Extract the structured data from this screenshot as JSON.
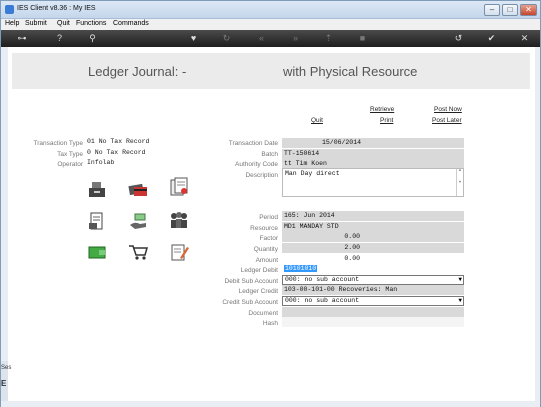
{
  "window": {
    "title": "IES Client v8.36 : My IES"
  },
  "menu": [
    "Help",
    "Submit",
    "Quit",
    "Functions",
    "Commands"
  ],
  "banner": {
    "left": "Ledger Journal: -",
    "right": "with Physical Resource"
  },
  "links": {
    "retrieve": "Retrieve",
    "post_now": "Post Now",
    "quit": "Quit",
    "print": "Print",
    "post_later": "Post Later"
  },
  "left_info": {
    "transaction_type_label": "Transaction Type",
    "transaction_type_value": "01 No Tax Record",
    "tax_type_label": "Tax Type",
    "tax_type_value": "0 No Tax Record",
    "operator_label": "Operator",
    "operator_value": "Infolab"
  },
  "form": {
    "transaction_date_label": "Transaction Date",
    "transaction_date": "15/06/2014",
    "batch_label": "Batch",
    "batch": "TT-150614",
    "authority_label": "Authority Code",
    "authority": "tt Tim Koen",
    "description_label": "Description",
    "description": "Man Day direct",
    "period_label": "Period",
    "period": "165: Jun 2014",
    "resource_label": "Resource",
    "resource": "MD1 MANDAY STD",
    "factor_label": "Factor",
    "factor": "0.00",
    "quantity_label": "Quantity",
    "quantity": "2.00",
    "amount_label": "Amount",
    "amount": "0.00",
    "ledger_debit_label": "Ledger Debit",
    "ledger_debit": "10101010",
    "debit_sub_label": "Debit Sub Account",
    "debit_sub": "000: no sub account",
    "ledger_credit_label": "Ledger Credit",
    "ledger_credit": "103-00-101-00 Recoveries: Man",
    "credit_sub_label": "Credit Sub Account",
    "credit_sub": "000: no sub account",
    "document_label": "Document",
    "document": "",
    "hash_label": "Hash",
    "hash": ""
  },
  "sidebar": {
    "top": "Ses",
    "bottom": "E"
  }
}
